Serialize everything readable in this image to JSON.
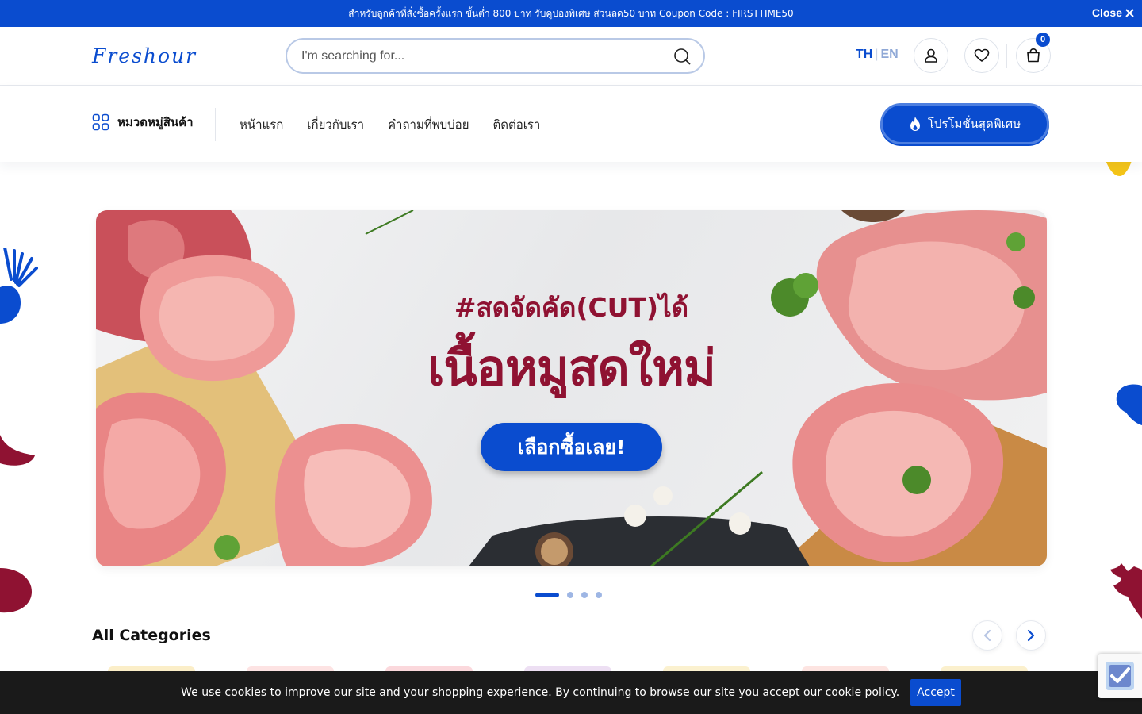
{
  "announcement": {
    "text": "สำหรับลูกค้าที่สั่งซื้อครั้งแรก ขั้นต่ำ 800 บาท รับคูปองพิเศษ ส่วนลด50 บาท Coupon Code : FIRSTTIME50",
    "close_label": "Close"
  },
  "header": {
    "logo_text": "Freshour",
    "search_placeholder": "I'm searching for...",
    "lang_th": "TH",
    "lang_sep": "|",
    "lang_en": "EN",
    "cart_count": "0"
  },
  "nav": {
    "categories_label": "หมวดหมู่สินค้า",
    "links": [
      "หน้าแรก",
      "เกี่ยวกับเรา",
      "คำถามที่พบบ่อย",
      "ติดต่อเรา"
    ],
    "promo_label": "โปรโมชั่นสุดพิเศษ"
  },
  "hero": {
    "tagline": "#สดจัดคัด(CUT)ได้",
    "title": "เนื้อหมูสดใหม่",
    "cta": "เลือกซื้อเลย!",
    "slides_total": 4,
    "slide_active": 1
  },
  "categories": {
    "title": "All Categories"
  },
  "cookie": {
    "text": "We use cookies to improve our site and your shopping experience. By continuing to browse our site you accept our cookie policy.",
    "accept_label": "Accept"
  },
  "colors": {
    "brand_blue": "#0a4ccf",
    "hero_red": "#8f1232",
    "cookie_bg": "#1a1a1a"
  }
}
